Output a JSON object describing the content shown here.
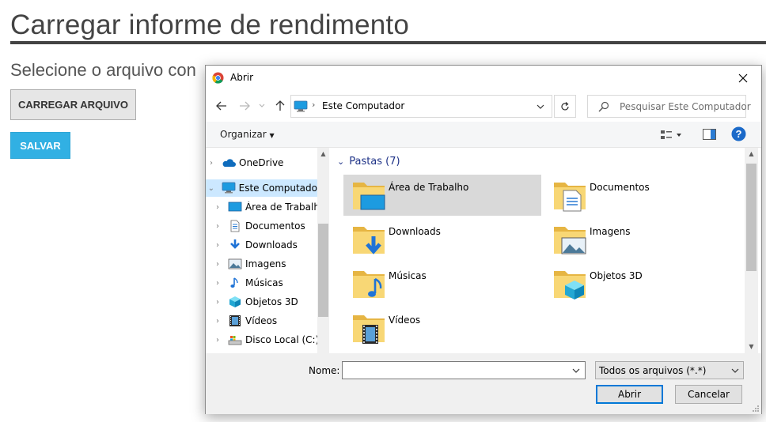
{
  "page": {
    "title": "Carregar informe de rendimento",
    "description": "Selecione o arquivo con",
    "upload_button": "CARREGAR ARQUIVO",
    "save_button": "SALVAR",
    "save_color": "#31b0e3"
  },
  "dialog": {
    "title": "Abrir",
    "address": {
      "separator": "›",
      "location": "Este Computador"
    },
    "search_placeholder": "Pesquisar Este Computador",
    "organize_label": "Organizar",
    "nav_items": [
      {
        "label": "OneDrive",
        "icon": "onedrive-icon",
        "chevron": "›"
      },
      {
        "label": "Este Computador",
        "icon": "computer-icon",
        "chevron": "⌄",
        "selected": true
      },
      {
        "label": "Área de Trabalho",
        "icon": "desktop-icon",
        "chevron": "›"
      },
      {
        "label": "Documentos",
        "icon": "documents-icon",
        "chevron": "›"
      },
      {
        "label": "Downloads",
        "icon": "downloads-icon",
        "chevron": "›"
      },
      {
        "label": "Imagens",
        "icon": "pictures-icon",
        "chevron": "›"
      },
      {
        "label": "Músicas",
        "icon": "music-icon",
        "chevron": "›"
      },
      {
        "label": "Objetos 3D",
        "icon": "objects-3d-icon",
        "chevron": "›"
      },
      {
        "label": "Vídeos",
        "icon": "videos-icon",
        "chevron": "›"
      },
      {
        "label": "Disco Local (C:)",
        "icon": "local-disk-icon",
        "chevron": "›"
      }
    ],
    "group_header": "Pastas (7)",
    "folders": [
      {
        "label": "Área de Trabalho",
        "icon": "desktop-folder-icon",
        "selected": true
      },
      {
        "label": "Documentos",
        "icon": "documents-folder-icon"
      },
      {
        "label": "Downloads",
        "icon": "downloads-folder-icon"
      },
      {
        "label": "Imagens",
        "icon": "pictures-folder-icon"
      },
      {
        "label": "Músicas",
        "icon": "music-folder-icon"
      },
      {
        "label": "Objetos 3D",
        "icon": "objects-3d-folder-icon"
      },
      {
        "label": "Vídeos",
        "icon": "videos-folder-icon"
      }
    ],
    "name_label": "Nome:",
    "name_value": "",
    "file_filter": "Todos os arquivos (*.*)",
    "open_button": "Abrir",
    "cancel_button": "Cancelar",
    "colors": {
      "selection": "#cce8ff",
      "tile_selected": "#d9d9d9",
      "header": "#1e3287",
      "help": "#1b6ac9"
    }
  }
}
